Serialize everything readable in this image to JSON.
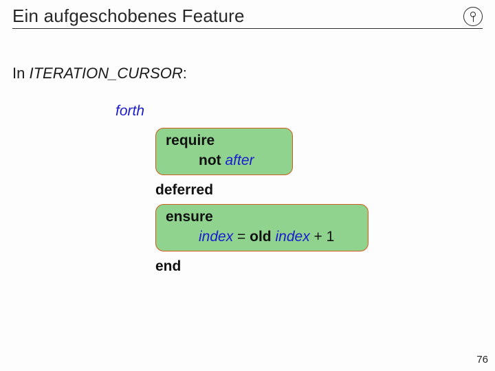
{
  "title": "Ein aufgeschobenes Feature",
  "intro": {
    "prefix": "In ",
    "classname": "ITERATION_CURSOR",
    "suffix": ":"
  },
  "code": {
    "feature": "forth",
    "require": {
      "kw": "require",
      "expr_kw": "not",
      "expr_id": "after"
    },
    "deferred": "deferred",
    "ensure": {
      "kw": "ensure",
      "lhs": "index",
      "eq": " = ",
      "old": "old",
      "rhs": "index",
      "plus": " + 1"
    },
    "end": "end"
  },
  "page": "76"
}
